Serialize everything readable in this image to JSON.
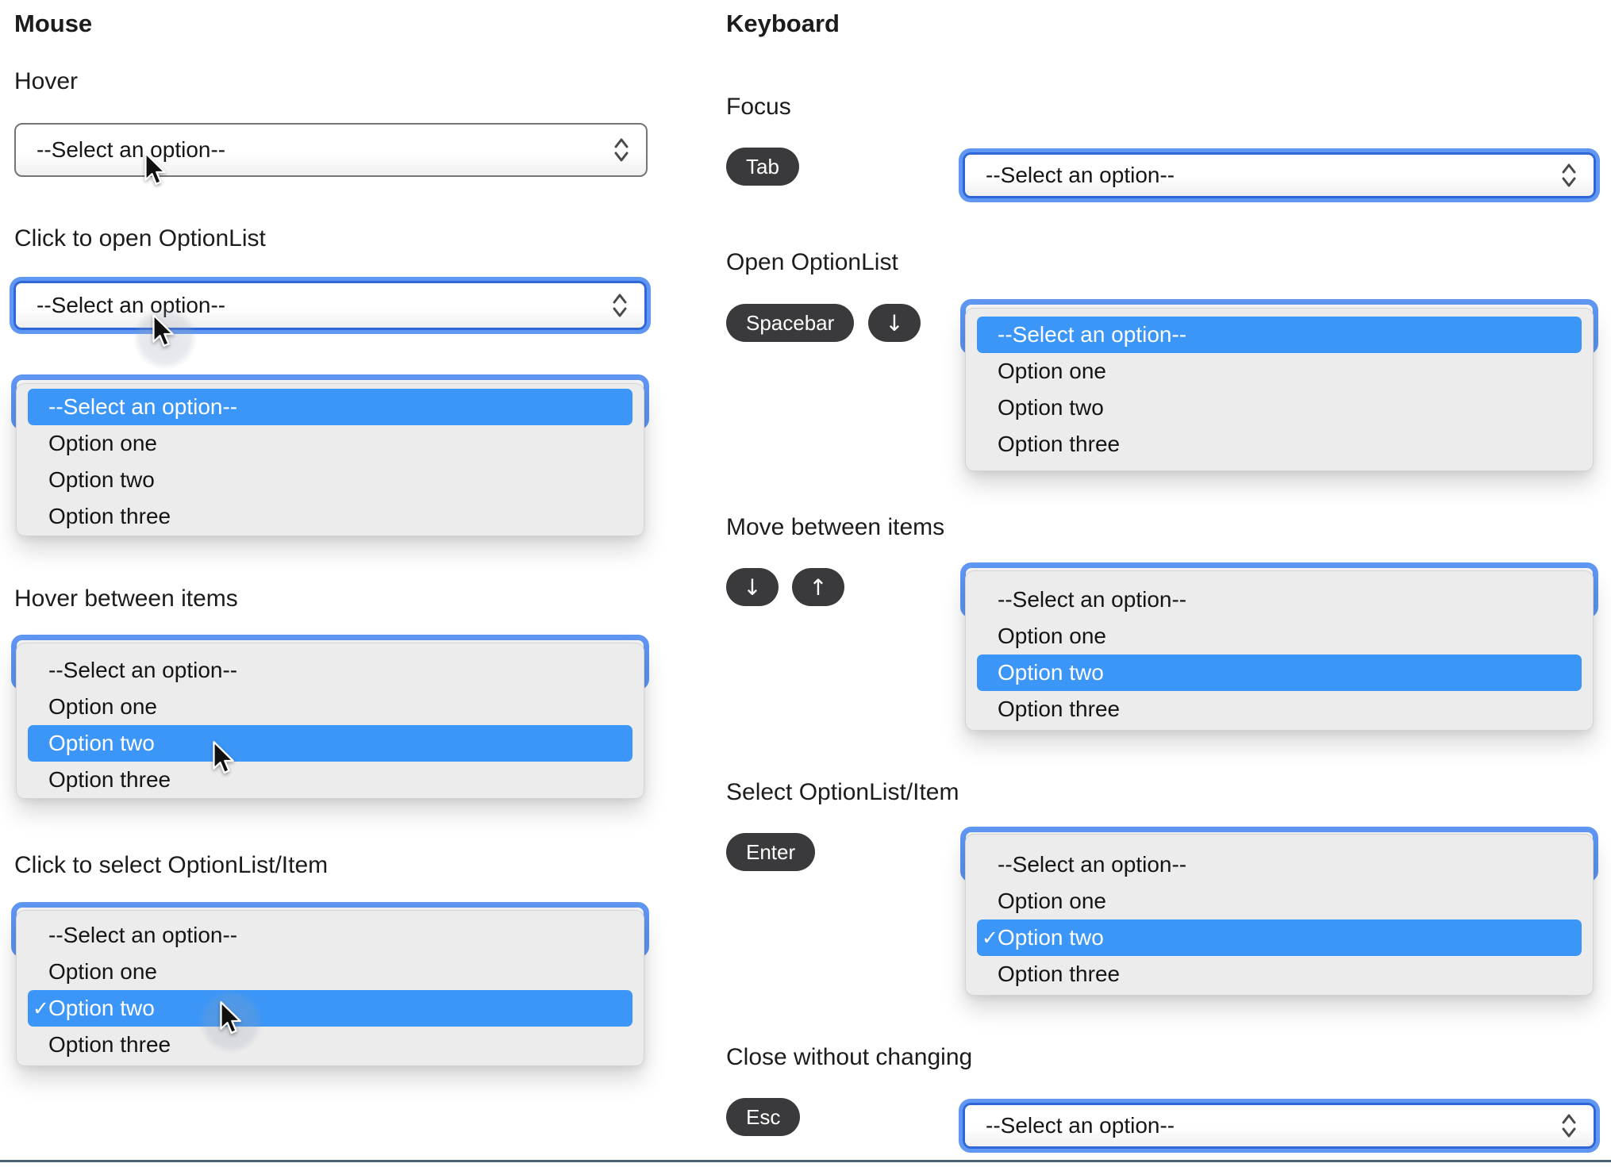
{
  "colors": {
    "highlight": "#3b96f7",
    "focus-ring-outer": "#5f97f3",
    "focus-ring-inner": "#2e66d9",
    "key-bg": "#3a3a3c",
    "panel-bg": "#ececec",
    "select-border": "#757575",
    "divider": "#4a6374"
  },
  "select": {
    "placeholder": "--Select an option--"
  },
  "options": [
    "--Select an option--",
    "Option one",
    "Option two",
    "Option three"
  ],
  "icons": {
    "checkmark": "✓",
    "arrow_down": "↓",
    "arrow_up": "↑"
  },
  "mouse": {
    "title": "Mouse",
    "hover_label": "Hover",
    "click_open_label": "Click to open OptionList",
    "hover_items_label": "Hover between items",
    "click_select_label": "Click to select OptionList/Item"
  },
  "keyboard": {
    "title": "Keyboard",
    "focus_label": "Focus",
    "open_label": "Open OptionList",
    "move_label": "Move between items",
    "select_label": "Select OptionList/Item",
    "close_label": "Close without changing",
    "keys": {
      "tab": "Tab",
      "spacebar": "Spacebar",
      "enter": "Enter",
      "esc": "Esc"
    }
  }
}
